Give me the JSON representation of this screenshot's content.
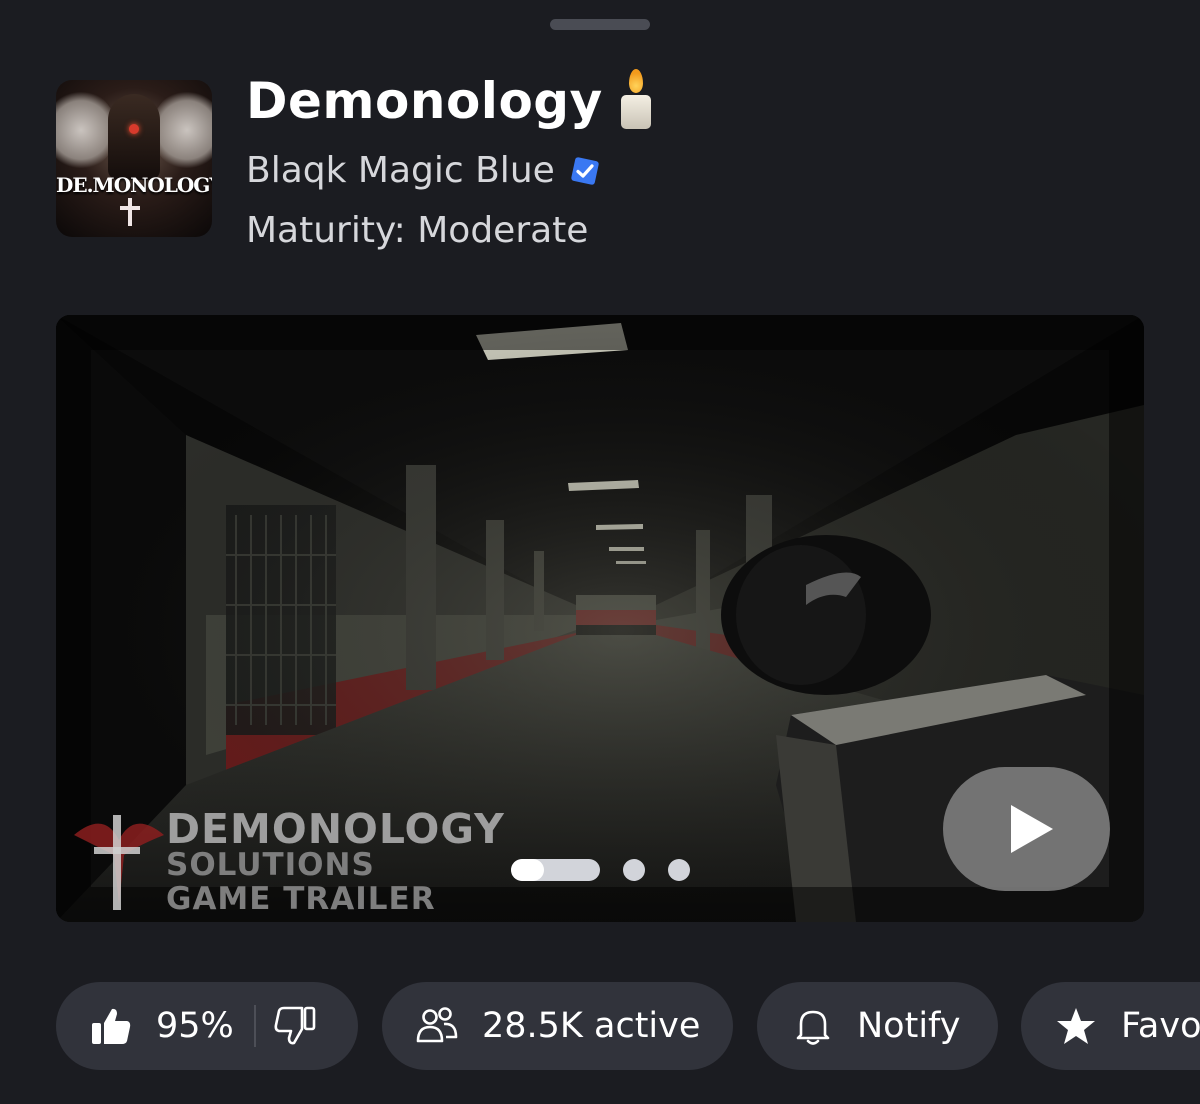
{
  "game": {
    "title": "Demonology",
    "thumbnail_text": "DE.MONOLOGY",
    "creator": "Blaqk Magic Blue",
    "maturity": "Maturity: Moderate"
  },
  "media": {
    "overlay_title": "DEMONOLOGY",
    "overlay_line1": "SOLUTIONS",
    "overlay_line2": "GAME TRAILER",
    "pager": {
      "total": 3,
      "current": 1
    }
  },
  "stats": {
    "rating": "95%",
    "active": "28.5K active",
    "notify": "Notify",
    "favorite": "Favo"
  },
  "colors": {
    "background": "#1b1c21",
    "pill": "#31333b",
    "verified": "#3a78f2"
  },
  "icons": [
    "candle-icon",
    "verified-badge-icon",
    "play-icon",
    "thumbs-up-icon",
    "thumbs-down-icon",
    "people-icon",
    "bell-icon",
    "star-icon"
  ]
}
